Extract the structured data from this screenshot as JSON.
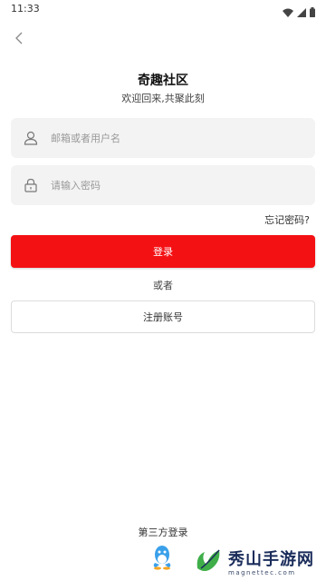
{
  "status_bar": {
    "time": "11:33",
    "icons": [
      "wifi-icon",
      "cellular-signal-icon",
      "battery-icon"
    ]
  },
  "header": {
    "back_icon": "chevron-left-icon",
    "title": "奇趣社区",
    "subtitle": "欢迎回来,共聚此刻"
  },
  "form": {
    "username": {
      "icon": "user-icon",
      "placeholder": "邮箱或者用户名",
      "value": ""
    },
    "password": {
      "icon": "lock-icon",
      "placeholder": "请输入密码",
      "value": ""
    },
    "forgot_label": "忘记密码?",
    "login_label": "登录",
    "or_label": "或者",
    "register_label": "注册账号"
  },
  "third_party": {
    "title": "第三方登录",
    "providers": [
      {
        "name": "QQ",
        "icon": "qq-penguin-icon"
      }
    ]
  },
  "watermark": {
    "main": "秀山手游网",
    "sub": "magnettec.com"
  },
  "colors": {
    "accent": "#f41114",
    "input_bg": "#f3f3f3",
    "qq_blue": "#3aa0ea"
  }
}
